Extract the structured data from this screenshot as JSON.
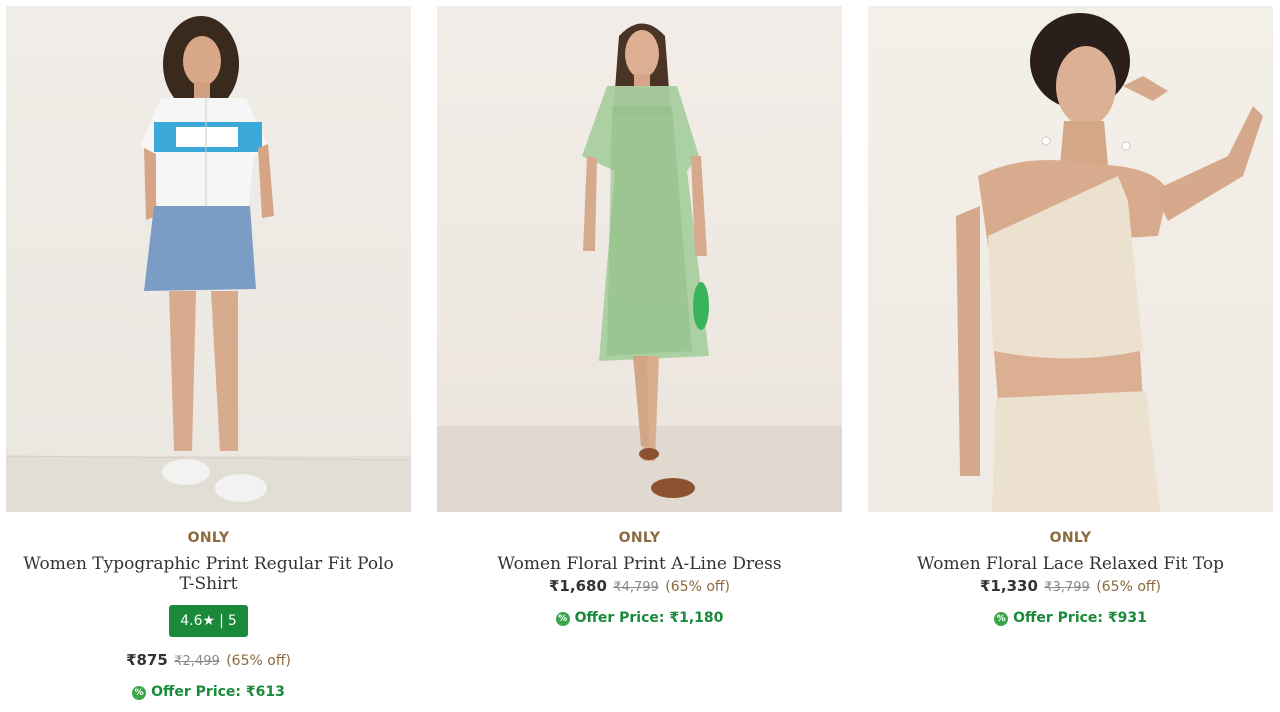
{
  "products": [
    {
      "brand": "ONLY",
      "title": "Women Typographic Print Regular Fit Polo T-Shirt",
      "rating": "4.6",
      "rating_star": "★",
      "rating_count": "5",
      "price": "₹875",
      "mrp": "₹2,499",
      "discount": "(65% off)",
      "offer_label": "Offer Price: ₹613"
    },
    {
      "brand": "ONLY",
      "title": "Women Floral Print A-Line Dress",
      "price": "₹1,680",
      "mrp": "₹4,799",
      "discount": "(65% off)",
      "offer_label": "Offer Price: ₹1,180"
    },
    {
      "brand": "ONLY",
      "title": "Women Floral Lace Relaxed Fit Top",
      "price": "₹1,330",
      "mrp": "₹3,799",
      "discount": "(65% off)",
      "offer_label": "Offer Price: ₹931"
    }
  ],
  "offer_icon_glyph": "%",
  "colors": {
    "brand_text": "#8b6b3d",
    "rating_badge": "#1a8a3a",
    "offer_text": "#1a8a3a"
  }
}
